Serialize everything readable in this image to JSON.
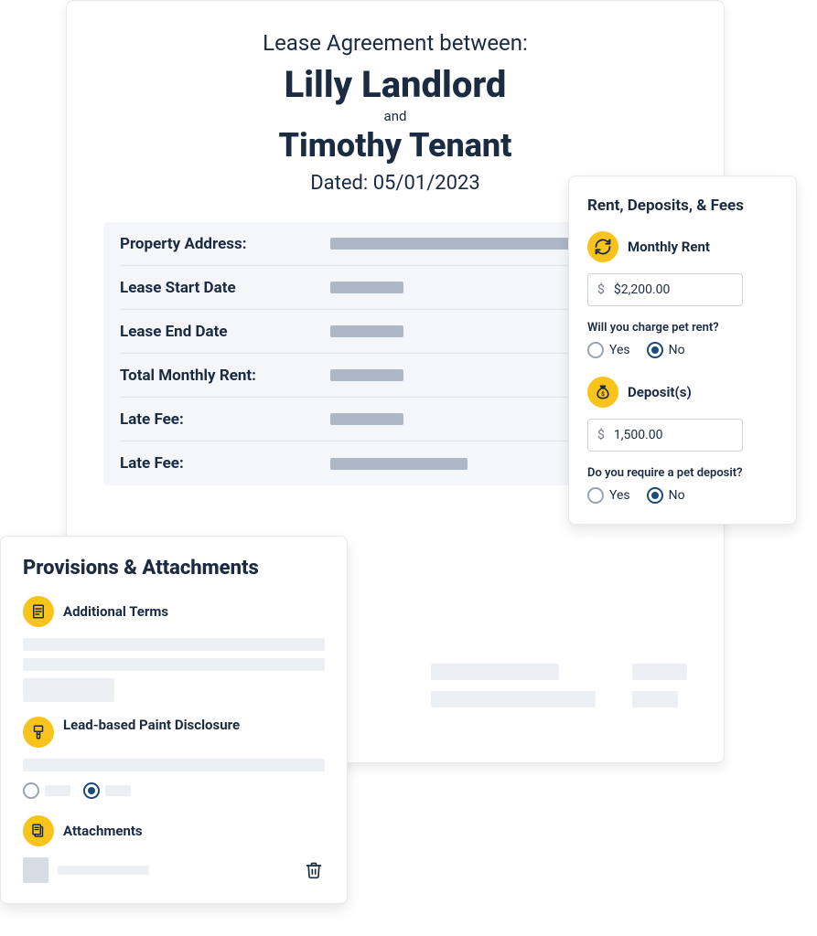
{
  "document": {
    "title_line": "Lease Agreement between:",
    "party1": "Lilly Landlord",
    "and": "and",
    "party2": "Timothy Tenant",
    "dated": "Dated: 05/01/2023",
    "fields": [
      {
        "label": "Property Address:"
      },
      {
        "label": "Lease Start Date"
      },
      {
        "label": "Lease End Date"
      },
      {
        "label": "Total Monthly Rent:"
      },
      {
        "label": "Late Fee:"
      },
      {
        "label": "Late Fee:"
      }
    ]
  },
  "rent_card": {
    "heading": "Rent, Deposits, & Fees",
    "monthly_rent_label": "Monthly Rent",
    "monthly_rent_symbol": "$",
    "monthly_rent_value": "$2,200.00",
    "pet_rent_question": "Will you charge pet rent?",
    "yes": "Yes",
    "no": "No",
    "pet_rent_answer": "No",
    "deposits_label": "Deposit(s)",
    "deposit_symbol": "$",
    "deposit_value": "1,500.00",
    "pet_deposit_question": "Do you require a pet deposit?",
    "pet_deposit_answer": "No"
  },
  "prov_card": {
    "heading": "Provisions & Attachments",
    "additional_terms": "Additional Terms",
    "lead_paint": "Lead-based Paint Disclosure",
    "attachments": "Attachments"
  }
}
